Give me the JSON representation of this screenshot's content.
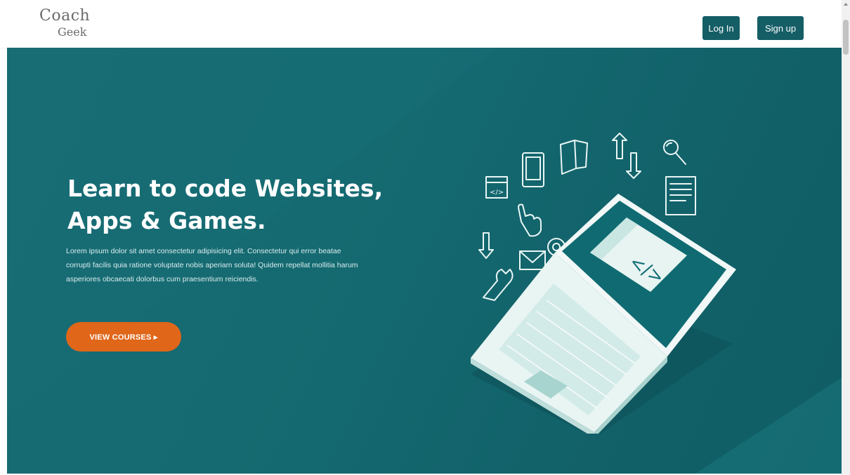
{
  "brand": {
    "logo_line1": "Coach",
    "logo_line2": "Geek"
  },
  "nav": {
    "login_label": "Log In",
    "signup_label": "Sign up"
  },
  "hero": {
    "title": "Learn to code Websites, Apps & Games.",
    "description": "Lorem ipsum dolor sit amet consectetur adipisicing elit. Consectetur qui error beatae corrupti facilis quia ratione voluptate nobis aperiam soluta! Quidem repellat mollitia harum asperiores obcaecati dolorbus cum praesentium reiciendis.",
    "cta_label": "VIEW COURSES ▸",
    "illustration_code_symbol": "</>"
  },
  "colors": {
    "hero_bg": "#156a71",
    "nav_button": "#155e66",
    "cta": "#e0661a"
  },
  "icons": [
    "laptop-icon",
    "tablet-icon",
    "book-icon",
    "upload-download-icon",
    "magnifier-icon",
    "code-window-icon",
    "document-icon",
    "pointer-hand-icon",
    "gear-icon",
    "envelope-icon",
    "down-arrow-icon",
    "wrench-icon"
  ]
}
